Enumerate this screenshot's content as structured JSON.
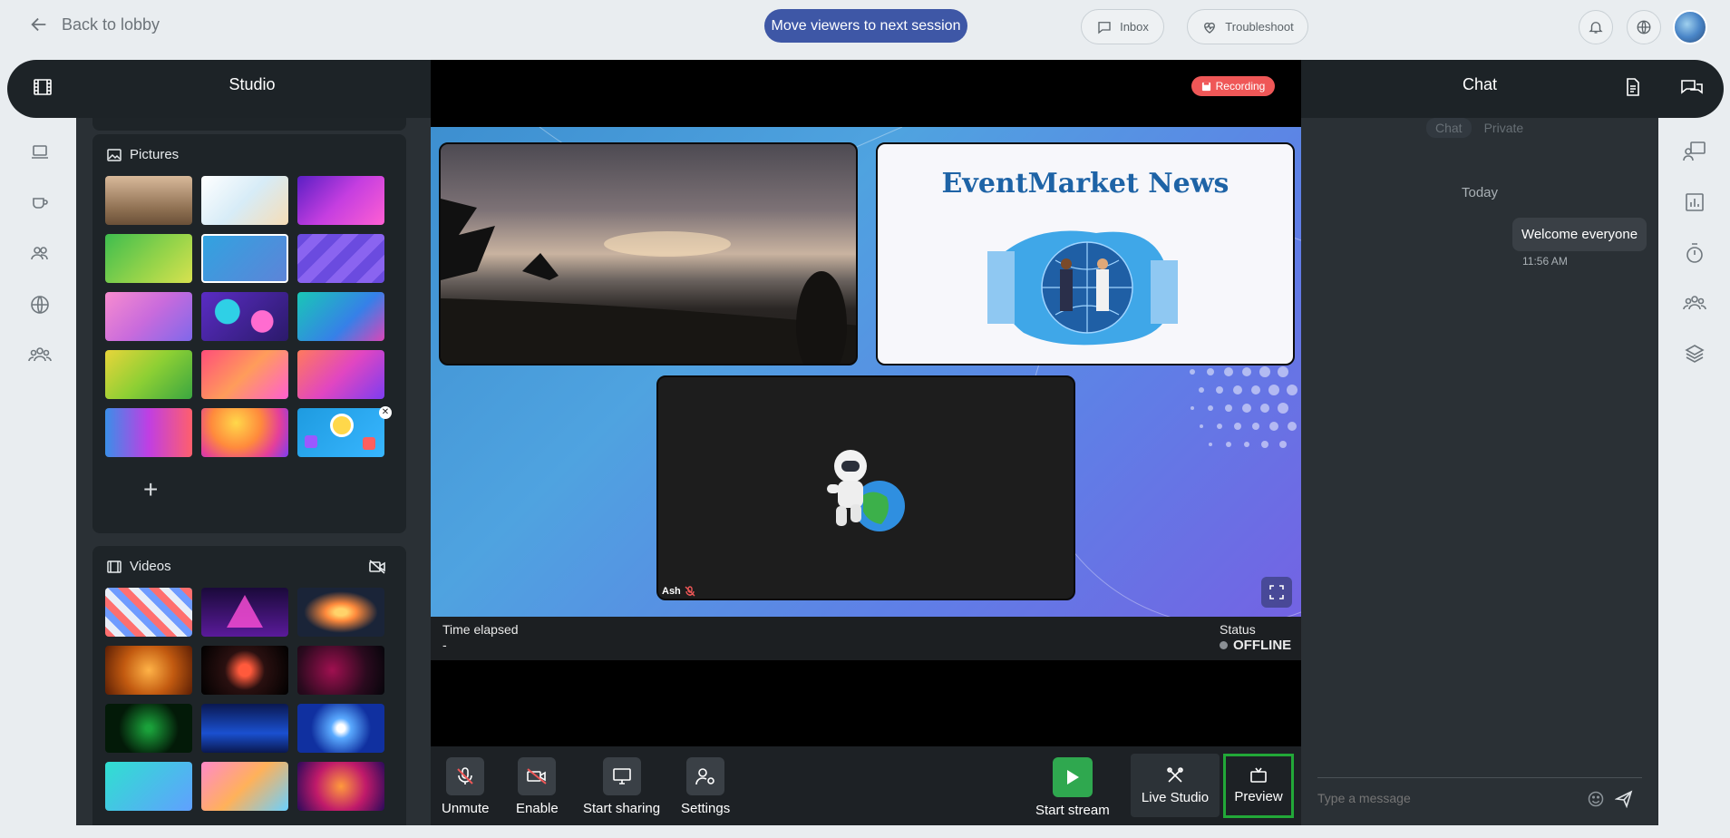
{
  "topbar": {
    "back_label": "Back to lobby",
    "move_viewers_label": "Move viewers to next session",
    "inbox_label": "Inbox",
    "troubleshoot_label": "Troubleshoot"
  },
  "studio": {
    "title": "Studio",
    "pictures_label": "Pictures",
    "videos_label": "Videos",
    "add_symbol": "+"
  },
  "stage": {
    "recording_label": "Recording",
    "slide_title": "EventMarket News",
    "participant_name": "Ash",
    "time_elapsed_label": "Time elapsed",
    "time_elapsed_value": "-",
    "status_label": "Status",
    "status_value": "OFFLINE"
  },
  "controls": {
    "unmute": "Unmute",
    "enable": "Enable",
    "start_sharing": "Start sharing",
    "settings": "Settings",
    "start_stream": "Start stream",
    "live_studio": "Live Studio",
    "preview": "Preview"
  },
  "chat": {
    "title": "Chat",
    "tab_chat": "Chat",
    "tab_private": "Private",
    "day_label": "Today",
    "message_text": "Welcome everyone",
    "message_time": "11:56 AM",
    "input_placeholder": "Type a message"
  },
  "colors": {
    "accent": "#3e57a6",
    "recording": "#ef5757",
    "stream_green": "#2fa84f",
    "preview_highlight": "#22a838",
    "panel_dark": "#1d2327"
  }
}
